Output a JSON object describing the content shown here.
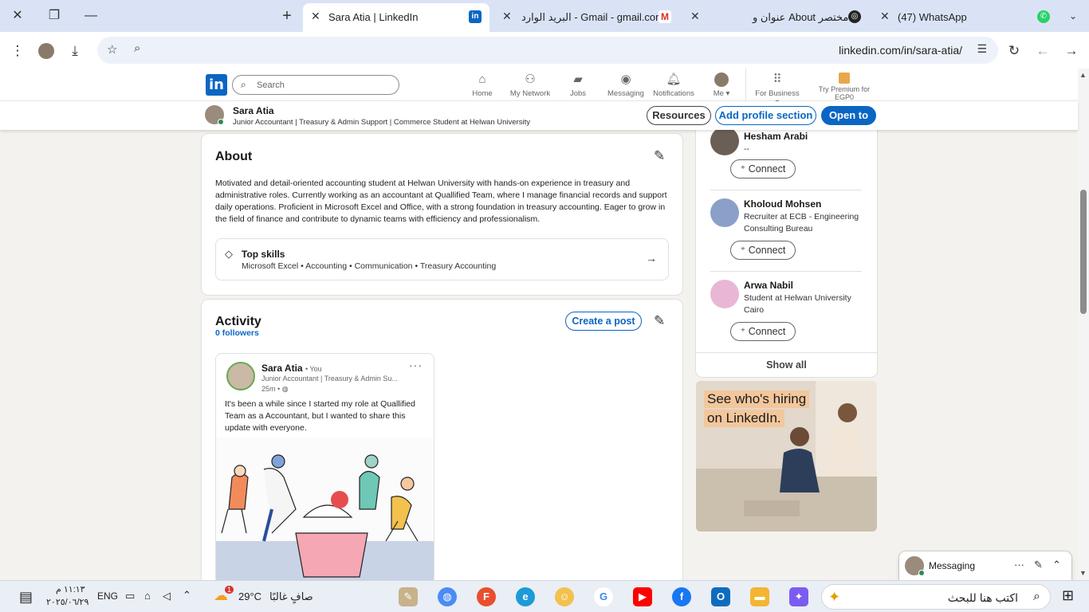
{
  "browser": {
    "tabs": [
      {
        "title": "Sara Atia | LinkedIn",
        "icon": "linkedin-icon"
      },
      {
        "title": "البريد الوارد - Gmail - gmail.com",
        "icon": "gmail-icon"
      },
      {
        "title": "عنوان و About مختصر",
        "icon": "chatgpt-icon"
      },
      {
        "title": "(47) WhatsApp",
        "icon": "whatsapp-icon"
      }
    ],
    "url": "linkedin.com/in/sara-atia/"
  },
  "linkedin": {
    "logo": "in",
    "search_placeholder": "Search",
    "nav": [
      {
        "label": "Home",
        "icon": "home-icon"
      },
      {
        "label": "My Network",
        "icon": "network-icon"
      },
      {
        "label": "Jobs",
        "icon": "jobs-icon"
      },
      {
        "label": "Messaging",
        "icon": "messaging-icon"
      },
      {
        "label": "Notifications",
        "icon": "bell-icon"
      },
      {
        "label": "Me",
        "icon": "avatar"
      },
      {
        "label": "For Business",
        "icon": "grid-icon"
      }
    ],
    "premium": "Try Premium for EGP0",
    "accent": "#0a66c2"
  },
  "sticky": {
    "name": "Sara Atia",
    "headline": "Junior Accountant | Treasury & Admin Support | Commerce Student at Helwan University",
    "buttons": {
      "resources": "Resources",
      "add_section": "Add profile section",
      "open_to": "Open to"
    }
  },
  "about": {
    "title": "About",
    "text": "Motivated and detail-oriented accounting student at Helwan University with hands-on experience in treasury and administrative roles. Currently working as an accountant at Quallified Team, where I manage financial records and support daily operations. Proficient in Microsoft Excel and Office, with a strong foundation in treasury accounting. Eager to grow in the field of finance and contribute to dynamic teams with efficiency and professionalism.",
    "skills_title": "Top skills",
    "skills": "Microsoft Excel • Accounting • Communication • Treasury Accounting"
  },
  "activity": {
    "title": "Activity",
    "followers": "0 followers",
    "create_post": "Create a post",
    "post": {
      "author": "Sara Atia",
      "you": "• You",
      "headline": "Junior Accountant | Treasury & Admin Su...",
      "time": "25m •",
      "text": "It's been a while since I started my role at Quallified Team as a Accountant, but I wanted to share this update with everyone."
    }
  },
  "people": [
    {
      "name": "Hesham Arabi",
      "headline": "--",
      "action": "Connect"
    },
    {
      "name": "Kholoud Mohsen",
      "headline": "Recruiter at ECB - Engineering Consulting Bureau",
      "action": "Connect"
    },
    {
      "name": "Arwa Nabil",
      "headline": "Student at Helwan University Cairo",
      "action": "Connect"
    }
  ],
  "show_all": "Show all",
  "ad": {
    "line1": "See who's hiring",
    "line2": "on LinkedIn."
  },
  "messaging": {
    "label": "Messaging"
  },
  "taskbar": {
    "search_placeholder": "اكتب هنا للبحث",
    "weather_temp": "29°C",
    "weather_text": "صافٍ غالبًا",
    "weather_badge": "1",
    "lang": "ENG",
    "time": "١١:١٣ م",
    "date": "٢٠٢٥/٠٦/٢٩"
  }
}
